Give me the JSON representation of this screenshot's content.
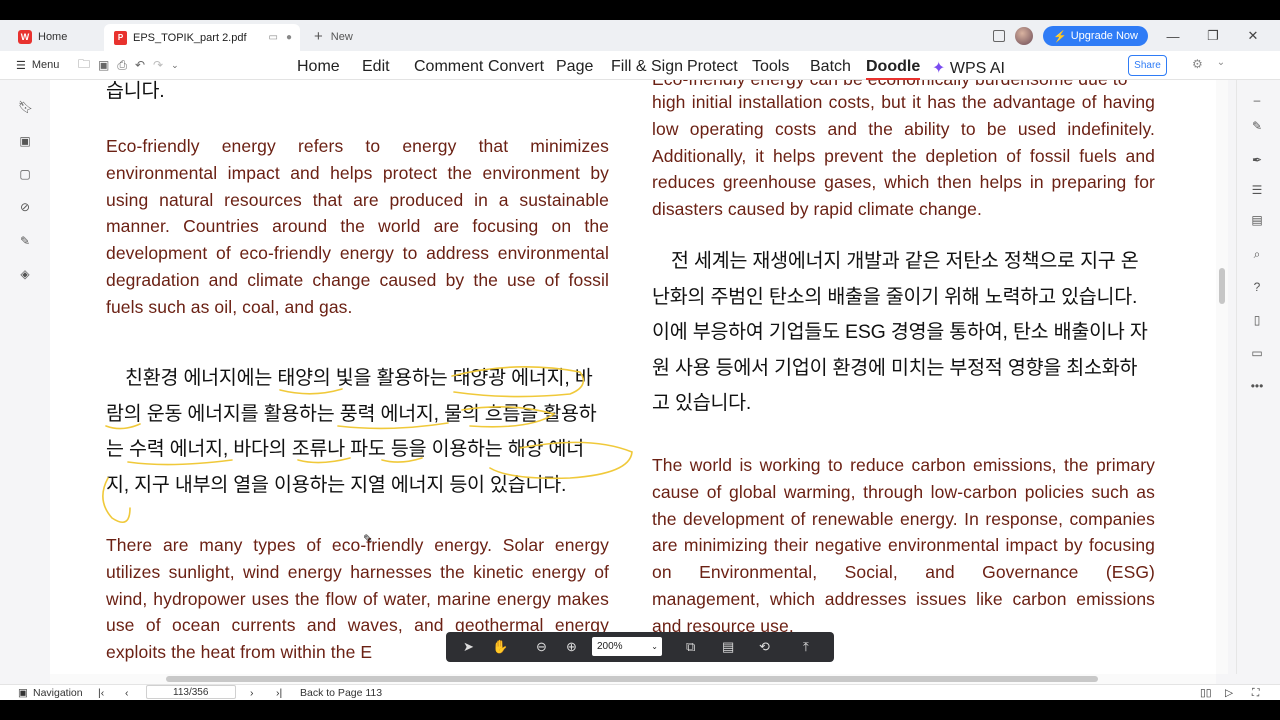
{
  "tabs": {
    "home": "Home",
    "file": "EPS_TOPIK_part 2.pdf",
    "new": "New"
  },
  "header": {
    "upgrade": "Upgrade Now"
  },
  "menubar": {
    "menu": "Menu",
    "items": [
      "Home",
      "Edit",
      "Comment",
      "Convert",
      "Page",
      "Fill & Sign",
      "Protect",
      "Tools",
      "Batch",
      "Doodle",
      "WPS AI"
    ],
    "active": "Doodle",
    "share": "Share"
  },
  "doc": {
    "left": {
      "top_fragment": "습니다.",
      "en1": "Eco-friendly energy refers to energy that minimizes environmental impact and helps protect the environment by using natural resources that are produced in a sustainable manner. Countries around the world are focusing on the development of eco-friendly energy to address environmental degradation and climate change caused by the use of fossil fuels such as oil, coal, and gas.",
      "ko_lines": [
        "친환경 에너지에는 태양의 빛을 활용하는 태양광 에너지, 바",
        "람의 운동 에너지를 활용하는 풍력 에너지, 물의 흐름을 활용하",
        "는 수력 에너지, 바다의 조류나 파도 등을 이용하는 해양 에너",
        "지, 지구 내부의 열을 이용하는 지열 에너지 등이 있습니다."
      ],
      "en2": "There are many types of eco-friendly energy. Solar energy utilizes sunlight, wind energy harnesses the kinetic energy of wind, hydropower uses the flow of water, marine energy makes use of ocean currents and waves, and geothermal energy exploits the heat from within the E"
    },
    "right": {
      "en1_top": "Eco-friendly energy can be economically burdensome due to",
      "en1": "high initial installation costs, but it has the advantage of having low operating costs and the ability to be used indefinitely. Additionally, it helps prevent the depletion of fossil fuels and reduces greenhouse gases, which then helps in preparing for disasters caused by rapid climate change.",
      "ko_lines": [
        "전 세계는 재생에너지 개발과 같은 저탄소 정책으로 지구 온",
        "난화의 주범인 탄소의 배출을 줄이기 위해 노력하고 있습니다.",
        "이에 부응하여 기업들도 ESG 경영을 통하여, 탄소 배출이나 자",
        "원 사용 등에서 기업이 환경에 미치는 부정적 영향을 최소화하",
        "고 있습니다."
      ],
      "en2": "The world is working to reduce carbon emissions, the primary cause of global warming, through low-carbon policies such as the development of renewable energy. In response, companies are minimizing their negative environmental impact by focusing on Environmental, Social, and Governance (ESG) management, which addresses issues like carbon emissions and resource use."
    }
  },
  "floatbar": {
    "zoom": "200%"
  },
  "status": {
    "navigation": "Navigation",
    "page": "113/356",
    "back": "Back to Page 113"
  },
  "colors": {
    "accent": "#2f7cf6",
    "brand_red": "#e8322e",
    "english_text": "#6b2114",
    "highlight_stroke": "#f0c93a"
  }
}
